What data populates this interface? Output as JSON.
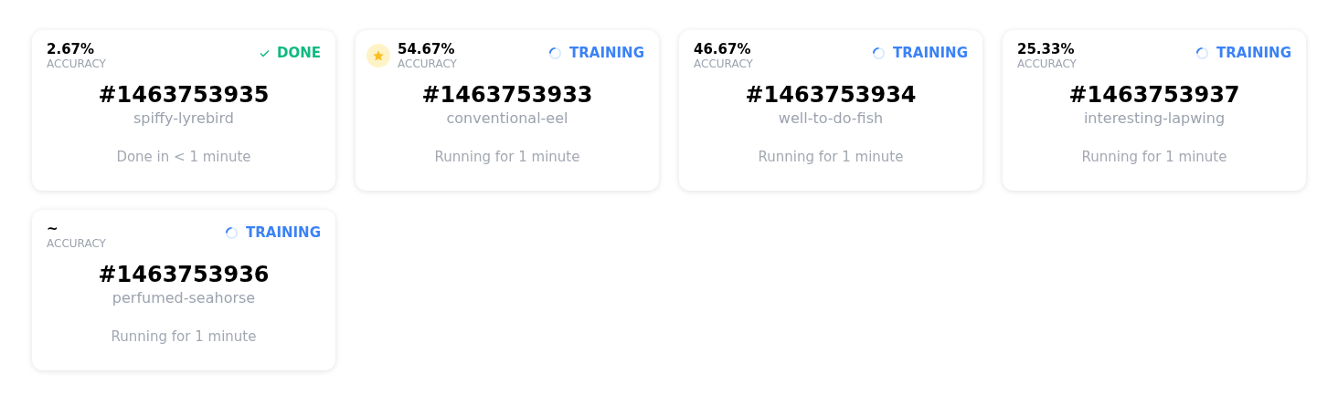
{
  "runs": [
    {
      "accuracy": "2.67%",
      "accuracy_label": "ACCURACY",
      "status": "DONE",
      "kind": "done",
      "best": false,
      "id": "#1463753935",
      "name": "spiffy-lyrebird",
      "duration": "Done in < 1 minute"
    },
    {
      "accuracy": "54.67%",
      "accuracy_label": "ACCURACY",
      "status": "TRAINING",
      "kind": "training",
      "best": true,
      "id": "#1463753933",
      "name": "conventional-eel",
      "duration": "Running for 1 minute"
    },
    {
      "accuracy": "46.67%",
      "accuracy_label": "ACCURACY",
      "status": "TRAINING",
      "kind": "training",
      "best": false,
      "id": "#1463753934",
      "name": "well-to-do-fish",
      "duration": "Running for 1 minute"
    },
    {
      "accuracy": "25.33%",
      "accuracy_label": "ACCURACY",
      "status": "TRAINING",
      "kind": "training",
      "best": false,
      "id": "#1463753937",
      "name": "interesting-lapwing",
      "duration": "Running for 1 minute"
    },
    {
      "accuracy": "~",
      "accuracy_label": "ACCURACY",
      "status": "TRAINING",
      "kind": "training",
      "best": false,
      "id": "#1463753936",
      "name": "perfumed-seahorse",
      "duration": "Running for 1 minute"
    }
  ]
}
